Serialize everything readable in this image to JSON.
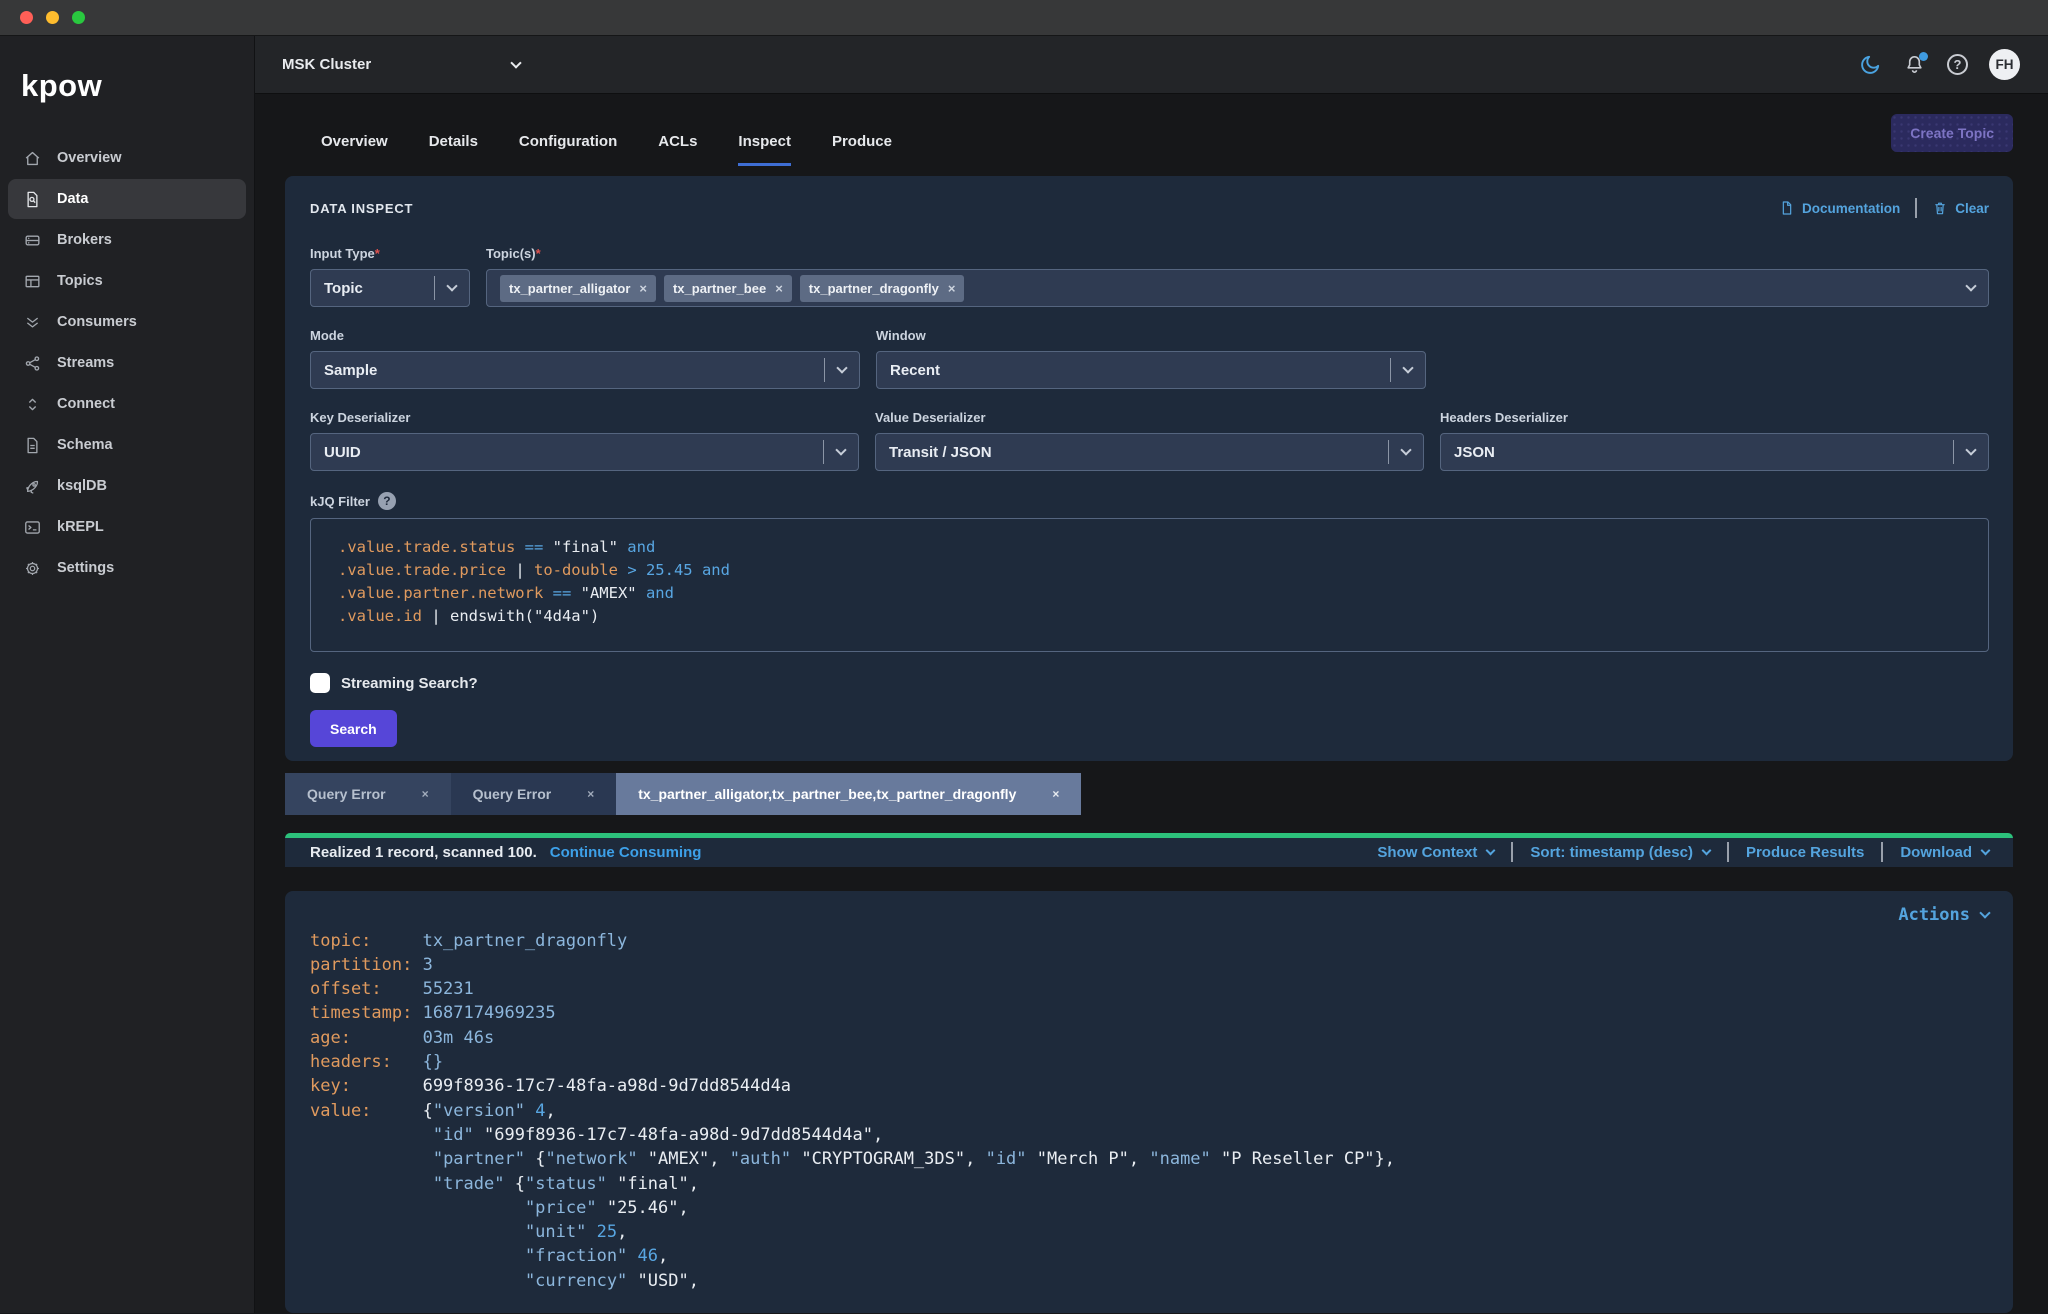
{
  "icons": {
    "close": "×",
    "question": "?",
    "required": "*"
  },
  "colors": {
    "accent_blue": "#54a4de",
    "link_blue": "#3da0e8",
    "purple_button": "#5646d8",
    "green_progress": "#2cc17b",
    "code_orange": "#e09a5e",
    "code_blue": "#58a6e2",
    "json_key_blue": "#8cb6dc",
    "panel_bg": "#1e2a3b",
    "tab_underline": "#3e6ed4",
    "active_result_tab": "#687a9c"
  },
  "sidebar": {
    "logo": "kpow",
    "items": [
      {
        "label": "Overview",
        "icon": "home"
      },
      {
        "label": "Data",
        "icon": "document-search",
        "active": true
      },
      {
        "label": "Brokers",
        "icon": "server"
      },
      {
        "label": "Topics",
        "icon": "table"
      },
      {
        "label": "Consumers",
        "icon": "chevrons-down"
      },
      {
        "label": "Streams",
        "icon": "share"
      },
      {
        "label": "Connect",
        "icon": "sort-arrows"
      },
      {
        "label": "Schema",
        "icon": "document"
      },
      {
        "label": "ksqlDB",
        "icon": "rocket"
      },
      {
        "label": "kREPL",
        "icon": "terminal"
      },
      {
        "label": "Settings",
        "icon": "gear"
      }
    ]
  },
  "topbar": {
    "cluster": "MSK Cluster",
    "avatar": "FH"
  },
  "page": {
    "tabs": [
      {
        "label": "Overview"
      },
      {
        "label": "Details"
      },
      {
        "label": "Configuration"
      },
      {
        "label": "ACLs"
      },
      {
        "label": "Inspect",
        "active": true
      },
      {
        "label": "Produce"
      }
    ],
    "create_topic": "Create Topic"
  },
  "inspect": {
    "title": "DATA INSPECT",
    "documentation_link": "Documentation",
    "clear_link": "Clear",
    "input_type": {
      "label": "Input Type",
      "value": "Topic"
    },
    "topics": {
      "label": "Topic(s)",
      "chips": [
        {
          "label": "tx_partner_alligator"
        },
        {
          "label": "tx_partner_bee"
        },
        {
          "label": "tx_partner_dragonfly"
        }
      ]
    },
    "mode": {
      "label": "Mode",
      "value": "Sample"
    },
    "window": {
      "label": "Window",
      "value": "Recent"
    },
    "key_deserializer": {
      "label": "Key Deserializer",
      "value": "UUID"
    },
    "value_deserializer": {
      "label": "Value Deserializer",
      "value": "Transit / JSON"
    },
    "headers_deserializer": {
      "label": "Headers Deserializer",
      "value": "JSON"
    },
    "kjq": {
      "label": "kJQ Filter",
      "lines": [
        {
          "tokens": [
            {
              "c": "o",
              "t": ".value.trade.status"
            },
            {
              "c": "b",
              "t": " == "
            },
            {
              "c": "w",
              "t": "\"final\""
            },
            {
              "c": "b",
              "t": " and"
            }
          ]
        },
        {
          "tokens": [
            {
              "c": "o",
              "t": ".value.trade.price"
            },
            {
              "c": "w",
              "t": " | "
            },
            {
              "c": "o",
              "t": "to-double"
            },
            {
              "c": "b",
              "t": " > 25.45 and"
            }
          ]
        },
        {
          "tokens": [
            {
              "c": "o",
              "t": ".value.partner.network"
            },
            {
              "c": "b",
              "t": " == "
            },
            {
              "c": "w",
              "t": "\"AMEX\""
            },
            {
              "c": "b",
              "t": " and"
            }
          ]
        },
        {
          "tokens": [
            {
              "c": "o",
              "t": ".value.id"
            },
            {
              "c": "w",
              "t": " | endswith(\"4d4a\")"
            }
          ]
        }
      ]
    },
    "streaming_label": "Streaming Search?",
    "search_button": "Search"
  },
  "result_tabs": [
    {
      "label": "Query Error"
    },
    {
      "label": "Query Error"
    },
    {
      "label": "tx_partner_alligator,tx_partner_bee,tx_partner_dragonfly",
      "active": true
    }
  ],
  "results_bar": {
    "status": "Realized 1 record, scanned 100.",
    "continue_link": "Continue Consuming",
    "show_context": "Show Context",
    "sort": "Sort: timestamp (desc)",
    "produce_results": "Produce Results",
    "download": "Download"
  },
  "record": {
    "actions": "Actions",
    "lines": [
      {
        "label": "topic:",
        "tokens": [
          {
            "c": "k",
            "t": "tx_partner_dragonfly"
          }
        ]
      },
      {
        "label": "partition:",
        "tokens": [
          {
            "c": "k",
            "t": "3"
          }
        ]
      },
      {
        "label": "offset:",
        "tokens": [
          {
            "c": "k",
            "t": "55231"
          }
        ]
      },
      {
        "label": "timestamp:",
        "tokens": [
          {
            "c": "k",
            "t": "1687174969235"
          }
        ]
      },
      {
        "label": "age:",
        "tokens": [
          {
            "c": "k",
            "t": "03m 46s"
          }
        ]
      },
      {
        "label": "headers:",
        "tokens": [
          {
            "c": "k",
            "t": "{}"
          }
        ]
      },
      {
        "label": "key:",
        "tokens": [
          {
            "c": "w",
            "t": "699f8936-17c7-48fa-a98d-9d7dd8544d4a"
          }
        ]
      },
      {
        "label": "value:",
        "tokens": [
          {
            "c": "w",
            "t": "{"
          },
          {
            "c": "k",
            "t": "\"version\""
          },
          {
            "c": "w",
            "t": " "
          },
          {
            "c": "n",
            "t": "4"
          },
          {
            "c": "w",
            "t": ","
          }
        ]
      },
      {
        "label": "",
        "tokens": [
          {
            "c": "w",
            "t": " "
          },
          {
            "c": "k",
            "t": "\"id\""
          },
          {
            "c": "w",
            "t": " \"699f8936-17c7-48fa-a98d-9d7dd8544d4a\","
          }
        ]
      },
      {
        "label": "",
        "tokens": [
          {
            "c": "w",
            "t": " "
          },
          {
            "c": "k",
            "t": "\"partner\""
          },
          {
            "c": "w",
            "t": " {"
          },
          {
            "c": "k",
            "t": "\"network\""
          },
          {
            "c": "w",
            "t": " \"AMEX\", "
          },
          {
            "c": "k",
            "t": "\"auth\""
          },
          {
            "c": "w",
            "t": " \"CRYPTOGRAM_3DS\", "
          },
          {
            "c": "k",
            "t": "\"id\""
          },
          {
            "c": "w",
            "t": " \"Merch P\", "
          },
          {
            "c": "k",
            "t": "\"name\""
          },
          {
            "c": "w",
            "t": " \"P Reseller CP\"},"
          }
        ]
      },
      {
        "label": "",
        "tokens": [
          {
            "c": "w",
            "t": " "
          },
          {
            "c": "k",
            "t": "\"trade\""
          },
          {
            "c": "w",
            "t": " {"
          },
          {
            "c": "k",
            "t": "\"status\""
          },
          {
            "c": "w",
            "t": " \"final\","
          }
        ]
      },
      {
        "label": "",
        "tokens": [
          {
            "c": "w",
            "t": "          "
          },
          {
            "c": "k",
            "t": "\"price\""
          },
          {
            "c": "w",
            "t": " \"25.46\","
          }
        ]
      },
      {
        "label": "",
        "tokens": [
          {
            "c": "w",
            "t": "          "
          },
          {
            "c": "k",
            "t": "\"unit\""
          },
          {
            "c": "w",
            "t": " "
          },
          {
            "c": "n",
            "t": "25"
          },
          {
            "c": "w",
            "t": ","
          }
        ]
      },
      {
        "label": "",
        "tokens": [
          {
            "c": "w",
            "t": "          "
          },
          {
            "c": "k",
            "t": "\"fraction\""
          },
          {
            "c": "w",
            "t": " "
          },
          {
            "c": "n",
            "t": "46"
          },
          {
            "c": "w",
            "t": ","
          }
        ]
      },
      {
        "label": "",
        "tokens": [
          {
            "c": "w",
            "t": "          "
          },
          {
            "c": "k",
            "t": "\"currency\""
          },
          {
            "c": "w",
            "t": " \"USD\","
          }
        ]
      }
    ]
  }
}
